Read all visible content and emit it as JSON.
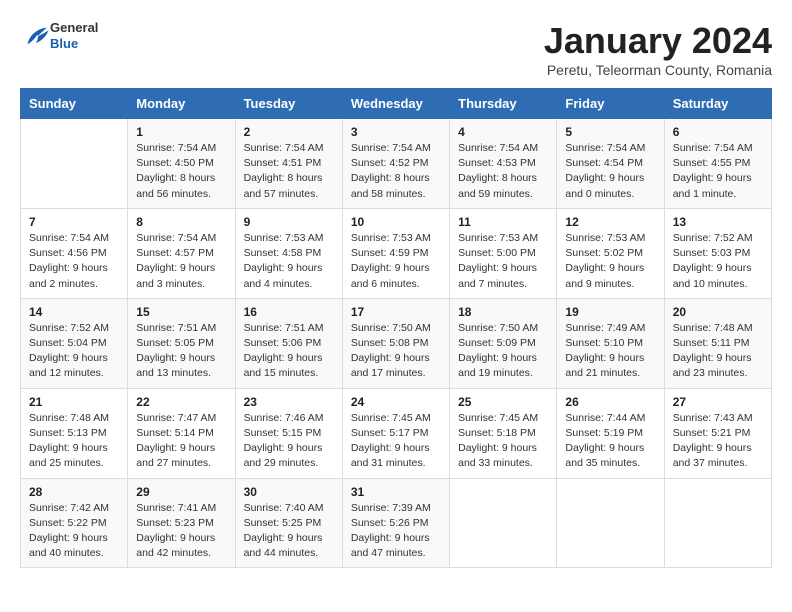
{
  "logo": {
    "general": "General",
    "blue": "Blue"
  },
  "title": "January 2024",
  "subtitle": "Peretu, Teleorman County, Romania",
  "days_header": [
    "Sunday",
    "Monday",
    "Tuesday",
    "Wednesday",
    "Thursday",
    "Friday",
    "Saturday"
  ],
  "weeks": [
    [
      {
        "day": "",
        "info": ""
      },
      {
        "day": "1",
        "info": "Sunrise: 7:54 AM\nSunset: 4:50 PM\nDaylight: 8 hours\nand 56 minutes."
      },
      {
        "day": "2",
        "info": "Sunrise: 7:54 AM\nSunset: 4:51 PM\nDaylight: 8 hours\nand 57 minutes."
      },
      {
        "day": "3",
        "info": "Sunrise: 7:54 AM\nSunset: 4:52 PM\nDaylight: 8 hours\nand 58 minutes."
      },
      {
        "day": "4",
        "info": "Sunrise: 7:54 AM\nSunset: 4:53 PM\nDaylight: 8 hours\nand 59 minutes."
      },
      {
        "day": "5",
        "info": "Sunrise: 7:54 AM\nSunset: 4:54 PM\nDaylight: 9 hours\nand 0 minutes."
      },
      {
        "day": "6",
        "info": "Sunrise: 7:54 AM\nSunset: 4:55 PM\nDaylight: 9 hours\nand 1 minute."
      }
    ],
    [
      {
        "day": "7",
        "info": "Sunrise: 7:54 AM\nSunset: 4:56 PM\nDaylight: 9 hours\nand 2 minutes."
      },
      {
        "day": "8",
        "info": "Sunrise: 7:54 AM\nSunset: 4:57 PM\nDaylight: 9 hours\nand 3 minutes."
      },
      {
        "day": "9",
        "info": "Sunrise: 7:53 AM\nSunset: 4:58 PM\nDaylight: 9 hours\nand 4 minutes."
      },
      {
        "day": "10",
        "info": "Sunrise: 7:53 AM\nSunset: 4:59 PM\nDaylight: 9 hours\nand 6 minutes."
      },
      {
        "day": "11",
        "info": "Sunrise: 7:53 AM\nSunset: 5:00 PM\nDaylight: 9 hours\nand 7 minutes."
      },
      {
        "day": "12",
        "info": "Sunrise: 7:53 AM\nSunset: 5:02 PM\nDaylight: 9 hours\nand 9 minutes."
      },
      {
        "day": "13",
        "info": "Sunrise: 7:52 AM\nSunset: 5:03 PM\nDaylight: 9 hours\nand 10 minutes."
      }
    ],
    [
      {
        "day": "14",
        "info": "Sunrise: 7:52 AM\nSunset: 5:04 PM\nDaylight: 9 hours\nand 12 minutes."
      },
      {
        "day": "15",
        "info": "Sunrise: 7:51 AM\nSunset: 5:05 PM\nDaylight: 9 hours\nand 13 minutes."
      },
      {
        "day": "16",
        "info": "Sunrise: 7:51 AM\nSunset: 5:06 PM\nDaylight: 9 hours\nand 15 minutes."
      },
      {
        "day": "17",
        "info": "Sunrise: 7:50 AM\nSunset: 5:08 PM\nDaylight: 9 hours\nand 17 minutes."
      },
      {
        "day": "18",
        "info": "Sunrise: 7:50 AM\nSunset: 5:09 PM\nDaylight: 9 hours\nand 19 minutes."
      },
      {
        "day": "19",
        "info": "Sunrise: 7:49 AM\nSunset: 5:10 PM\nDaylight: 9 hours\nand 21 minutes."
      },
      {
        "day": "20",
        "info": "Sunrise: 7:48 AM\nSunset: 5:11 PM\nDaylight: 9 hours\nand 23 minutes."
      }
    ],
    [
      {
        "day": "21",
        "info": "Sunrise: 7:48 AM\nSunset: 5:13 PM\nDaylight: 9 hours\nand 25 minutes."
      },
      {
        "day": "22",
        "info": "Sunrise: 7:47 AM\nSunset: 5:14 PM\nDaylight: 9 hours\nand 27 minutes."
      },
      {
        "day": "23",
        "info": "Sunrise: 7:46 AM\nSunset: 5:15 PM\nDaylight: 9 hours\nand 29 minutes."
      },
      {
        "day": "24",
        "info": "Sunrise: 7:45 AM\nSunset: 5:17 PM\nDaylight: 9 hours\nand 31 minutes."
      },
      {
        "day": "25",
        "info": "Sunrise: 7:45 AM\nSunset: 5:18 PM\nDaylight: 9 hours\nand 33 minutes."
      },
      {
        "day": "26",
        "info": "Sunrise: 7:44 AM\nSunset: 5:19 PM\nDaylight: 9 hours\nand 35 minutes."
      },
      {
        "day": "27",
        "info": "Sunrise: 7:43 AM\nSunset: 5:21 PM\nDaylight: 9 hours\nand 37 minutes."
      }
    ],
    [
      {
        "day": "28",
        "info": "Sunrise: 7:42 AM\nSunset: 5:22 PM\nDaylight: 9 hours\nand 40 minutes."
      },
      {
        "day": "29",
        "info": "Sunrise: 7:41 AM\nSunset: 5:23 PM\nDaylight: 9 hours\nand 42 minutes."
      },
      {
        "day": "30",
        "info": "Sunrise: 7:40 AM\nSunset: 5:25 PM\nDaylight: 9 hours\nand 44 minutes."
      },
      {
        "day": "31",
        "info": "Sunrise: 7:39 AM\nSunset: 5:26 PM\nDaylight: 9 hours\nand 47 minutes."
      },
      {
        "day": "",
        "info": ""
      },
      {
        "day": "",
        "info": ""
      },
      {
        "day": "",
        "info": ""
      }
    ]
  ]
}
